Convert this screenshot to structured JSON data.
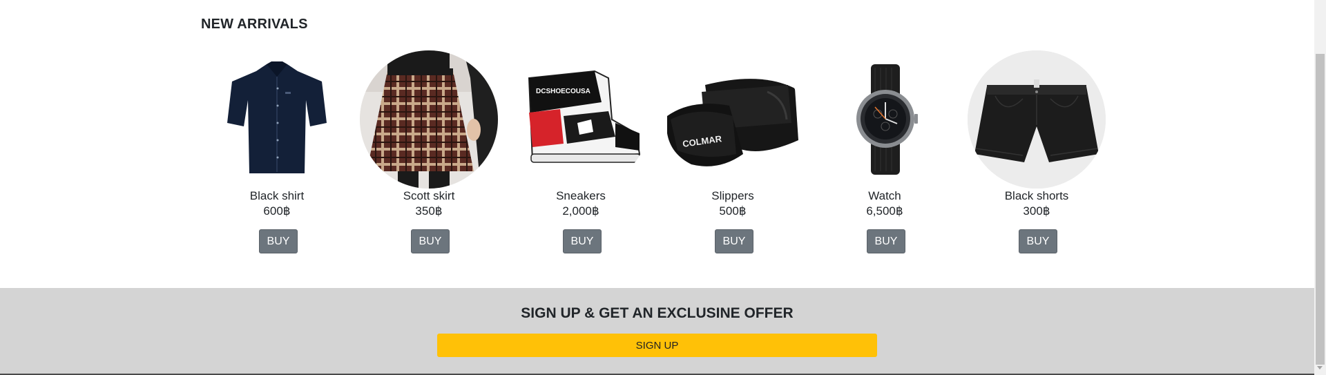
{
  "new_arrivals": {
    "title": "NEW ARRIVALS",
    "buy_label": "BUY",
    "products": [
      {
        "name": "Black shirt",
        "price": "600฿",
        "image_icon": "black-shirt-image"
      },
      {
        "name": "Scott skirt",
        "price": "350฿",
        "image_icon": "plaid-skirt-image"
      },
      {
        "name": "Sneakers",
        "price": "2,000฿",
        "image_icon": "sneaker-image"
      },
      {
        "name": "Slippers",
        "price": "500฿",
        "image_icon": "slipper-image"
      },
      {
        "name": "Watch",
        "price": "6,500฿",
        "image_icon": "watch-image"
      },
      {
        "name": "Black shorts",
        "price": "300฿",
        "image_icon": "shorts-image"
      }
    ]
  },
  "signup": {
    "title": "SIGN UP & GET AN EXCLUSINE OFFER",
    "button_label": "SIGN UP"
  },
  "colors": {
    "buy_button": "#6c757d",
    "signup_button": "#ffc107",
    "signup_background": "#d4d4d4"
  }
}
